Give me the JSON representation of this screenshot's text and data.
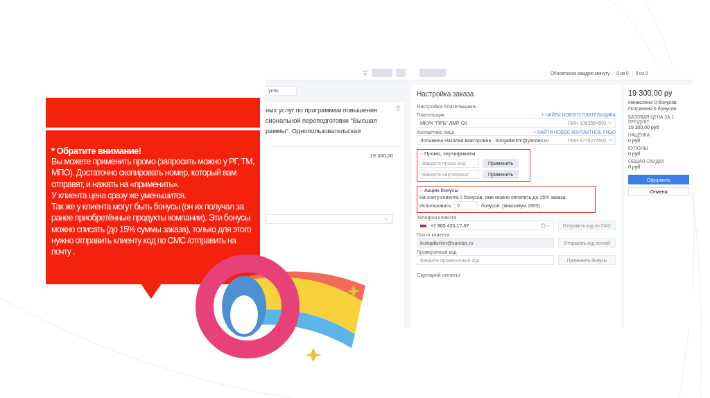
{
  "note": {
    "heading": "* Обратите внимание!",
    "paragraphs": [
      "Вы можете применить промо (запросить можно у РГ, ТМ, МПО). Достаточно скопировать номер, который вам отправят, и нажать на «применить».",
      "У клиента цена сразу же уменьшится.",
      "Так же у клиента могут быть бонусы (он их получал за ранее приобретённые продукты компании). Эти бонусы можно списать (до 15% суммы заказа), только для этого нужно отправить клиенту код по СМС /отправить на почту ."
    ]
  },
  "screenshot": {
    "topbar": {
      "update_label": "Обновление каждую минуту",
      "counters": [
        "0 из 0",
        "0 из 0"
      ]
    },
    "product": {
      "filter_value": "укты",
      "title_lines": [
        "ных услуг по программам повышения",
        "сиональной переподготовки \"Высшая",
        "раммы\". Однопользовательская"
      ],
      "price": "19 300,00"
    },
    "order": {
      "title": "Настройка заказа",
      "payer_title": "Настройка плательщика",
      "fields": [
        {
          "label": "Плательщик",
          "link": "+ НАЙТИ НОВОГО ПЛАТЕЛЬЩИКА",
          "value": "МКУК \"ПРБ\" ЛМР СК",
          "pin": "ПИН 1063554501"
        },
        {
          "label": "Контактное лицо",
          "link": "+ НАЙТИ НОВОЕ КОНТАКТНОЕ ЛИЦО",
          "value": "Лотымина Наталья Викторовна - buhgalterlmr@yandex.ru",
          "pin": "ПИН 4776274501"
        }
      ],
      "promo": {
        "title": "Промо, сертификаты",
        "expanded": true,
        "highlighted": true,
        "rows": [
          {
            "placeholder": "Введите промо-код",
            "button": "Применить"
          },
          {
            "placeholder": "Введите сертификат",
            "button": "Применить"
          }
        ]
      },
      "bonuses": {
        "title": "Акции-бонусы",
        "expanded": true,
        "highlighted": true,
        "info": "На счету клиента 0 бонусов, ими можно оплатить до 15% заказа.",
        "use_label": "Использовать",
        "value": "0",
        "suffix": "бонусов. (максимум 2895)"
      },
      "contacts": [
        {
          "kind": "phone",
          "label": "Телефон клиента",
          "value": "+7 865 433-17-97",
          "disabled": false,
          "button": "Отправить код по СМС"
        },
        {
          "kind": "email",
          "label": "Почта клиента",
          "value": "buhgalterlmr@yandex.ru",
          "disabled": true,
          "button": "Отправить код почтой"
        },
        {
          "kind": "code",
          "label": "Проверочный код",
          "placeholder": "Введите проверочный код",
          "disabled": false,
          "button": "Применить бонусы"
        }
      ],
      "payment_title": "Сценарий оплаты"
    },
    "summary": {
      "total": "19 300,00 ру",
      "lines": [
        "Начислено 0 бонусов",
        "Потрачено 0 бонусов"
      ],
      "items": [
        {
          "label": "БАЗОВАЯ ЦЕНА ЗА 1 ПРОДУКТ",
          "value": "19 300,00 руб"
        },
        {
          "label": "НАЦЕНКА",
          "value": "0 руб"
        },
        {
          "label": "КУПОНЫ",
          "value": "0 руб"
        },
        {
          "label": "ОБЩАЯ СКИДКА",
          "value": "0 руб"
        }
      ],
      "submit": "Оформить",
      "cancel": "Отмена"
    }
  }
}
